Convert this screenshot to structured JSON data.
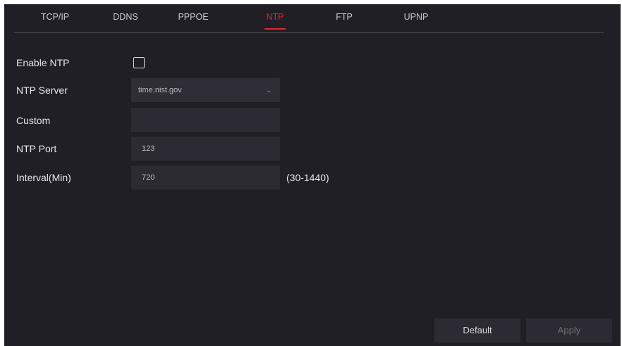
{
  "tabs": [
    {
      "label": "TCP/IP"
    },
    {
      "label": "DDNS"
    },
    {
      "label": "PPPOE"
    },
    {
      "label": "NTP",
      "active": true
    },
    {
      "label": "FTP"
    },
    {
      "label": "UPNP"
    }
  ],
  "form": {
    "enable_ntp_label": "Enable NTP",
    "enable_ntp_checked": false,
    "ntp_server_label": "NTP Server",
    "ntp_server_value": "time.nist.gov",
    "custom_label": "Custom",
    "custom_value": "",
    "ntp_port_label": "NTP Port",
    "ntp_port_value": "123",
    "interval_label": "Interval(Min)",
    "interval_value": "720",
    "interval_range": "(30-1440)"
  },
  "buttons": {
    "default_label": "Default",
    "apply_label": "Apply"
  },
  "colors": {
    "background": "#201f26",
    "field": "#2c2b33",
    "accent": "#e0262c",
    "text": "#e6e6ea"
  },
  "icons": {
    "dropdown": "chevron-down-icon"
  }
}
